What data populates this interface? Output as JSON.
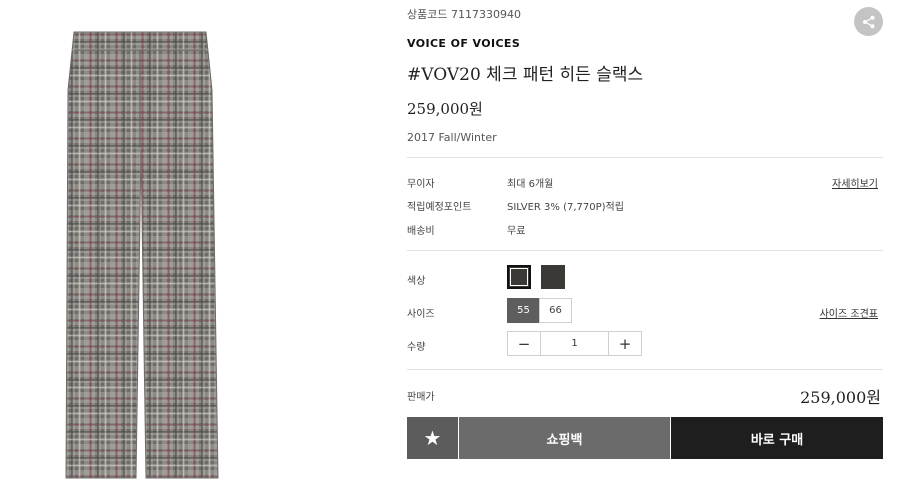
{
  "product": {
    "code": "상품코드 7117330940",
    "brand": "VOICE OF VOICES",
    "title": "#VOV20 체크 패턴 히든 슬랙스",
    "price": "259,000원",
    "season": "2017 Fall/Winter",
    "image_icon": "check-slacks-image"
  },
  "info_rows": [
    {
      "label": "무이자",
      "value": "최대 6개월",
      "link": "자세히보기"
    },
    {
      "label": "적립예정포인트",
      "value": "SILVER 3% (7,770P)적립"
    },
    {
      "label": "배송비",
      "value": "무료"
    }
  ],
  "options": {
    "color_label": "색상",
    "colors": [
      "#3b3935",
      "#3b3935"
    ],
    "size_label": "사이즈",
    "sizes": [
      "55",
      "66"
    ],
    "selected_size": "55",
    "size_chart_link": "사이즈 조견표",
    "quantity_label": "수량",
    "quantity": "1",
    "minus": "−",
    "plus": "+"
  },
  "summary": {
    "label": "판매가",
    "total": "259,000원"
  },
  "actions": {
    "favorite_icon": "★",
    "cart": "쇼핑백",
    "buy": "바로 구매"
  },
  "colors": {
    "cart_button": "#6b6b6b",
    "buy_button": "#1e1e1e",
    "favorite_button": "#5c5c5c",
    "share_button": "#c4c4c4"
  }
}
